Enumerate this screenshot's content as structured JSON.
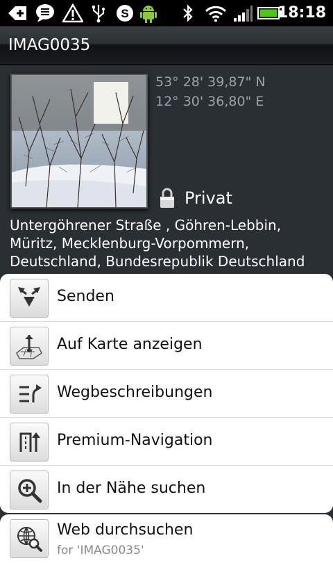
{
  "status_bar": {
    "time": "18:18",
    "icons": [
      "usb-debug-icon",
      "sms-icon",
      "warning-icon",
      "usb-icon",
      "skype-icon",
      "android-icon",
      "bluetooth-icon",
      "wifi-icon",
      "signal-icon",
      "battery-icon"
    ]
  },
  "header": {
    "title": "IMAG0035"
  },
  "details": {
    "latitude": "53° 28' 39,87\" N",
    "longitude": "12° 30' 36,80\" E",
    "privacy": "Privat",
    "address": "Untergöhrener Straße , Göhren-Lebbin, Müritz, Mecklenburg-Vorpommern, Deutschland, Bundesrepublik Deutschland"
  },
  "actions": [
    {
      "label": "Senden",
      "icon": "share-icon"
    },
    {
      "label": "Auf Karte anzeigen",
      "icon": "map-pin-icon"
    },
    {
      "label": "Wegbeschreibungen",
      "icon": "directions-icon"
    },
    {
      "label": "Premium-Navigation",
      "icon": "navigation-icon"
    },
    {
      "label": "In der Nähe suchen",
      "icon": "nearby-search-icon"
    }
  ],
  "web_search": {
    "label": "Web durchsuchen",
    "sub": "for 'IMAG0035'"
  }
}
